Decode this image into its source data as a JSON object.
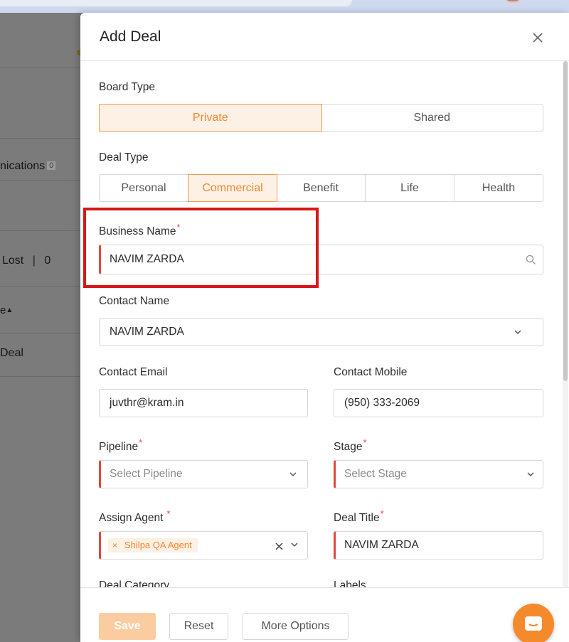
{
  "background": {
    "communications_label": "nications",
    "communications_count": "0",
    "lost_label": "Lost",
    "lost_count": "0",
    "sort_label": "e",
    "deal_label": "Deal"
  },
  "modal": {
    "title": "Add Deal",
    "board_type": {
      "label": "Board Type",
      "options": [
        "Private",
        "Shared"
      ],
      "selected": "Private"
    },
    "deal_type": {
      "label": "Deal Type",
      "options": [
        "Personal",
        "Commercial",
        "Benefit",
        "Life",
        "Health"
      ],
      "selected": "Commercial"
    },
    "business_name": {
      "label": "Business Name",
      "value": "NAVIM ZARDA"
    },
    "contact_name": {
      "label": "Contact Name",
      "value": "NAVIM ZARDA"
    },
    "contact_email": {
      "label": "Contact Email",
      "value": "juvthr@kram.in"
    },
    "contact_mobile": {
      "label": "Contact Mobile",
      "value": "(950) 333-2069"
    },
    "pipeline": {
      "label": "Pipeline",
      "placeholder": "Select Pipeline"
    },
    "stage": {
      "label": "Stage",
      "placeholder": "Select Stage"
    },
    "assign_agent": {
      "label": "Assign Agent",
      "tag": "Shilpa QA Agent"
    },
    "deal_title": {
      "label": "Deal Title",
      "value": "NAVIM ZARDA"
    },
    "deal_category": {
      "label": "Deal Category"
    },
    "labels": {
      "label": "Labels"
    }
  },
  "footer": {
    "save_label": "Save",
    "reset_label": "Reset",
    "more_options_label": "More Options"
  },
  "colors": {
    "accent": "#f08a2f",
    "accent_bg": "#fdf0e5",
    "required": "#e0483c",
    "highlight": "#d71818"
  }
}
